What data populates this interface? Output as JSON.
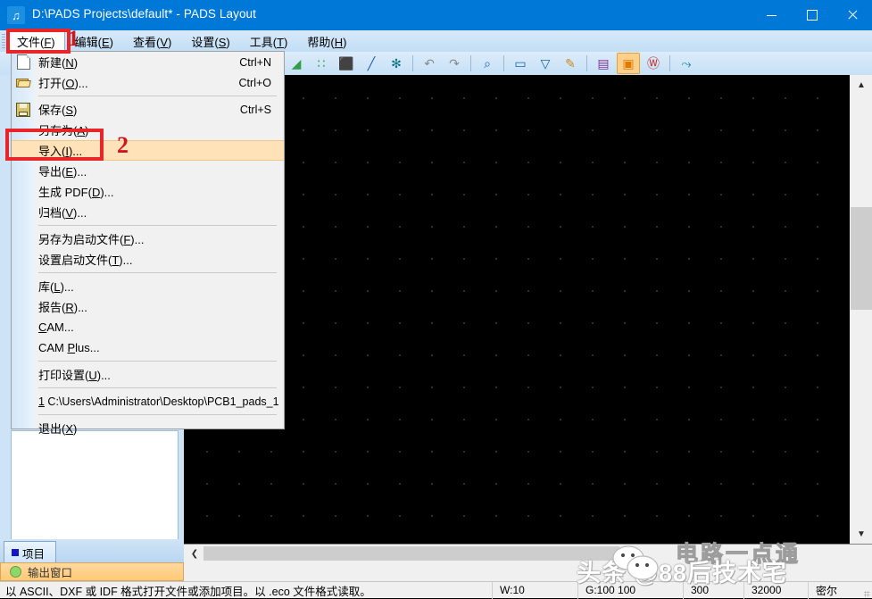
{
  "window": {
    "title": "D:\\PADS Projects\\default* - PADS Layout",
    "app_icon": "pads-layout-icon",
    "minimize": "–",
    "maximize": "□",
    "close": "✕"
  },
  "menubar": {
    "items": [
      {
        "label": "文件",
        "mnemonic": "F",
        "active": true,
        "name": "menu-file"
      },
      {
        "label": "编辑",
        "mnemonic": "E",
        "active": false,
        "name": "menu-edit"
      },
      {
        "label": "查看",
        "mnemonic": "V",
        "active": false,
        "name": "menu-view"
      },
      {
        "label": "设置",
        "mnemonic": "S",
        "active": false,
        "name": "menu-setup"
      },
      {
        "label": "工具",
        "mnemonic": "T",
        "active": false,
        "name": "menu-tools"
      },
      {
        "label": "帮助",
        "mnemonic": "H",
        "active": false,
        "name": "menu-help"
      }
    ]
  },
  "toolbar": {
    "buttons": [
      {
        "name": "design-rules-icon",
        "glyph": "◢",
        "color": "#2f9e44",
        "active": false
      },
      {
        "name": "pour-manager-icon",
        "glyph": "∷",
        "color": "#2f9e44",
        "active": false
      },
      {
        "name": "board-outline-icon",
        "glyph": "⬛",
        "color": "#c92a2a",
        "active": false
      },
      {
        "name": "route-icon",
        "glyph": "╱",
        "color": "#1c5fb4",
        "active": false
      },
      {
        "name": "split-plane-icon",
        "glyph": "✻",
        "color": "#0b7285",
        "active": false
      },
      {
        "name": "undo-icon",
        "glyph": "↶",
        "color": "#8a8a8a",
        "active": false
      },
      {
        "name": "redo-icon",
        "glyph": "↷",
        "color": "#8a8a8a",
        "active": false
      },
      {
        "name": "zoom-icon",
        "glyph": "⌕",
        "color": "#1c5fb4",
        "active": false
      },
      {
        "name": "view-board-icon",
        "glyph": "▭",
        "color": "#1864ab",
        "active": false
      },
      {
        "name": "view-extents-icon",
        "glyph": "▽",
        "color": "#1864ab",
        "active": false
      },
      {
        "name": "redraw-icon",
        "glyph": "✎",
        "color": "#c78a1a",
        "active": false
      },
      {
        "name": "layers-icon",
        "glyph": "▤",
        "color": "#862e9c",
        "active": false
      },
      {
        "name": "display-colors-icon",
        "glyph": "▣",
        "color": "#e67700",
        "active": true
      },
      {
        "name": "query-modeless-icon",
        "glyph": "Ⓦ",
        "color": "#c92a2a",
        "active": false
      },
      {
        "name": "net-icon",
        "glyph": "⤳",
        "color": "#0c8599",
        "active": false
      }
    ]
  },
  "file_menu": {
    "items": [
      {
        "type": "item",
        "label": "新建",
        "mnemonic": "N",
        "suffix": "",
        "accel": "Ctrl+N",
        "icon": "new-file-icon",
        "name": "menu-item-new"
      },
      {
        "type": "item",
        "label": "打开",
        "mnemonic": "O",
        "suffix": "...",
        "accel": "Ctrl+O",
        "icon": "open-file-icon",
        "name": "menu-item-open"
      },
      {
        "type": "sep"
      },
      {
        "type": "item",
        "label": "保存",
        "mnemonic": "S",
        "suffix": "",
        "accel": "Ctrl+S",
        "icon": "save-file-icon",
        "name": "menu-item-save"
      },
      {
        "type": "item",
        "label": "另存为",
        "mnemonic": "A",
        "suffix": "",
        "accel": "",
        "icon": "",
        "name": "menu-item-save-as"
      },
      {
        "type": "item",
        "label": "导入",
        "mnemonic": "I",
        "suffix": "...",
        "accel": "",
        "icon": "",
        "highlight": true,
        "name": "menu-item-import"
      },
      {
        "type": "item",
        "label": "导出",
        "mnemonic": "E",
        "suffix": "...",
        "accel": "",
        "icon": "",
        "name": "menu-item-export"
      },
      {
        "type": "item",
        "label": "生成 PDF",
        "mnemonic": "D",
        "suffix": "...",
        "accel": "",
        "icon": "",
        "name": "menu-item-generate-pdf"
      },
      {
        "type": "item",
        "label": "归档",
        "mnemonic": "V",
        "suffix": "...",
        "accel": "",
        "icon": "",
        "name": "menu-item-archive"
      },
      {
        "type": "sep"
      },
      {
        "type": "item",
        "label": "另存为启动文件",
        "mnemonic": "F",
        "suffix": "...",
        "accel": "",
        "icon": "",
        "name": "menu-item-save-as-startup"
      },
      {
        "type": "item",
        "label": "设置启动文件",
        "mnemonic": "T",
        "suffix": "...",
        "accel": "",
        "icon": "",
        "name": "menu-item-set-startup"
      },
      {
        "type": "sep"
      },
      {
        "type": "item",
        "label": "库",
        "mnemonic": "L",
        "suffix": "...",
        "accel": "",
        "icon": "",
        "name": "menu-item-library"
      },
      {
        "type": "item",
        "label": "报告",
        "mnemonic": "R",
        "suffix": "...",
        "accel": "",
        "icon": "",
        "name": "menu-item-reports"
      },
      {
        "type": "item",
        "label": "CAM",
        "mnemonic": "C",
        "suffix": "...",
        "accel": "",
        "icon": "",
        "lead": true,
        "name": "menu-item-cam"
      },
      {
        "type": "item",
        "label": "CAM Plus",
        "mnemonic": "P",
        "suffix": "...",
        "accel": "",
        "icon": "",
        "inner": true,
        "name": "menu-item-cam-plus"
      },
      {
        "type": "sep"
      },
      {
        "type": "item",
        "label": "打印设置",
        "mnemonic": "U",
        "suffix": "...",
        "accel": "",
        "icon": "",
        "name": "menu-item-print-setup"
      },
      {
        "type": "sep"
      },
      {
        "type": "recent",
        "label": "1 C:\\Users\\Administrator\\Desktop\\PCB1_pads_1",
        "name": "menu-item-recent-file-1"
      },
      {
        "type": "sep"
      },
      {
        "type": "item",
        "label": "退出",
        "mnemonic": "X",
        "suffix": "",
        "accel": "",
        "icon": "",
        "name": "menu-item-exit"
      }
    ]
  },
  "left_panel": {
    "tab_label": "项目",
    "output_window_label": "输出窗口"
  },
  "statusbar": {
    "message": "以 ASCII、DXF 或 IDF 格式打开文件或添加项目。以 .eco 文件格式读取。",
    "fields": [
      {
        "label": "W:10",
        "name": "status-width"
      },
      {
        "label": "G:100 100",
        "name": "status-grid"
      },
      {
        "label": "300",
        "name": "status-value-300"
      },
      {
        "label": "32000",
        "name": "status-value-32000"
      },
      {
        "label": "密尔",
        "name": "status-units"
      }
    ]
  },
  "annotations": {
    "step1": "1",
    "step2": "2"
  },
  "watermarks": {
    "primary": "头条 @88后技术宅",
    "secondary": "电路一点通"
  },
  "colors": {
    "accent": "#0078d7",
    "titlebar": "#0078d7",
    "menu_highlight": "#ffe2b8",
    "annotation_red": "#e8262a",
    "canvas_bg": "#000000",
    "panel_bg": "#cfe3f6"
  }
}
